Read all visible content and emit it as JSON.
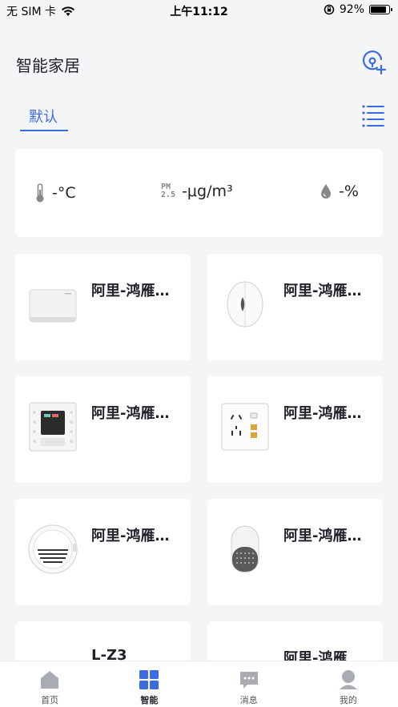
{
  "status_bar": {
    "carrier": "无 SIM 卡",
    "time": "上午11:12",
    "battery_text": "92%",
    "battery_level": 0.92
  },
  "header": {
    "title": "智能家居"
  },
  "tabs": {
    "active": "默认"
  },
  "environment": {
    "temperature": "-°C",
    "pm25_label_top": "PM",
    "pm25_label_bottom": "2.5",
    "pm25": "-μg/m³",
    "humidity": "-%"
  },
  "devices": [
    {
      "name": "阿里-鸿雁智能网关",
      "icon": "gateway-icon"
    },
    {
      "name": "阿里-鸿雁门磁传感器",
      "icon": "door-sensor-icon"
    },
    {
      "name": "阿里-鸿雁智能面板",
      "icon": "switch-panel-icon"
    },
    {
      "name": "阿里-鸿雁智能插座",
      "icon": "socket-icon"
    },
    {
      "name": "阿里-鸿雁烟雾报警器",
      "icon": "smoke-detector-icon"
    },
    {
      "name": "阿里-鸿雁智能音箱",
      "icon": "speaker-icon"
    },
    {
      "name": "L-Z3",
      "icon": "device-icon"
    },
    {
      "name": "阿里-鸿雁",
      "icon": "panel-icon"
    }
  ],
  "tabbar": {
    "home": "首页",
    "smart": "智能",
    "messages": "消息",
    "mine": "我的"
  },
  "colors": {
    "accent": "#3c6be0",
    "background": "#f4f5f7"
  }
}
